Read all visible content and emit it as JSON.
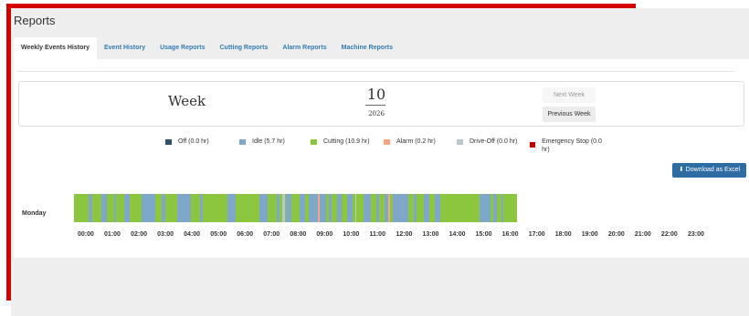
{
  "page": {
    "title": "Reports"
  },
  "tabs": [
    {
      "label": "Weekly Events History",
      "active": true
    },
    {
      "label": "Event History",
      "active": false
    },
    {
      "label": "Usage Reports",
      "active": false
    },
    {
      "label": "Cutting Reports",
      "active": false
    },
    {
      "label": "Alarm Reports",
      "active": false
    },
    {
      "label": "Machine Reports",
      "active": false
    }
  ],
  "week": {
    "label": "Week",
    "number": "10",
    "year": "2026",
    "next_label": "Next Week",
    "prev_label": "Previous Week"
  },
  "legend": [
    {
      "label": "Off (0.0 hr)",
      "color": "#2f4f6f"
    },
    {
      "label": "Idle (5.7 hr)",
      "color": "#7fa7c9"
    },
    {
      "label": "Cutting (10.9 hr)",
      "color": "#8cc63f"
    },
    {
      "label": "Alarm (0.2 hr)",
      "color": "#f4a582"
    },
    {
      "label": "Drive-Off (0.0 hr)",
      "color": "#b8c8c8"
    },
    {
      "label": "Emergency Stop (0.0 hr)",
      "color": "#c00000"
    }
  ],
  "download_label": "Download as Excel",
  "day": {
    "label": "Monday"
  },
  "timeline": {
    "start_hour": 0,
    "end_hour": 16.7,
    "idle_segments": [
      [
        0.55,
        0.7
      ],
      [
        1.05,
        1.25
      ],
      [
        1.5,
        1.6
      ],
      [
        1.9,
        2.1
      ],
      [
        2.55,
        3.05
      ],
      [
        3.3,
        3.45
      ],
      [
        3.9,
        4.4
      ],
      [
        4.75,
        4.85
      ],
      [
        5.8,
        6.1
      ],
      [
        7.0,
        7.3
      ],
      [
        7.65,
        7.75
      ],
      [
        8.0,
        8.2
      ],
      [
        8.5,
        8.7
      ],
      [
        8.85,
        9.5
      ],
      [
        9.6,
        9.7
      ],
      [
        9.9,
        10.1
      ],
      [
        10.3,
        10.5
      ],
      [
        10.9,
        11.2
      ],
      [
        11.4,
        11.5
      ],
      [
        11.7,
        11.9
      ],
      [
        12.0,
        12.6
      ],
      [
        12.8,
        12.9
      ],
      [
        13.2,
        13.4
      ],
      [
        13.6,
        13.8
      ],
      [
        15.3,
        15.7
      ],
      [
        15.8,
        15.95
      ],
      [
        16.1,
        16.2
      ]
    ],
    "alarm_segments": [
      [
        9.2,
        9.28
      ],
      [
        11.85,
        11.9
      ]
    ],
    "offline_segments": [
      [
        7.85,
        7.95
      ],
      [
        10.6,
        10.65
      ]
    ]
  },
  "hours": [
    "00:00",
    "01:00",
    "02:00",
    "03:00",
    "04:00",
    "05:00",
    "06:00",
    "07:00",
    "08:00",
    "09:00",
    "10:00",
    "11:00",
    "12:00",
    "13:00",
    "14:00",
    "15:00",
    "16:00",
    "17:00",
    "18:00",
    "19:00",
    "20:00",
    "21:00",
    "22:00",
    "23:00"
  ]
}
